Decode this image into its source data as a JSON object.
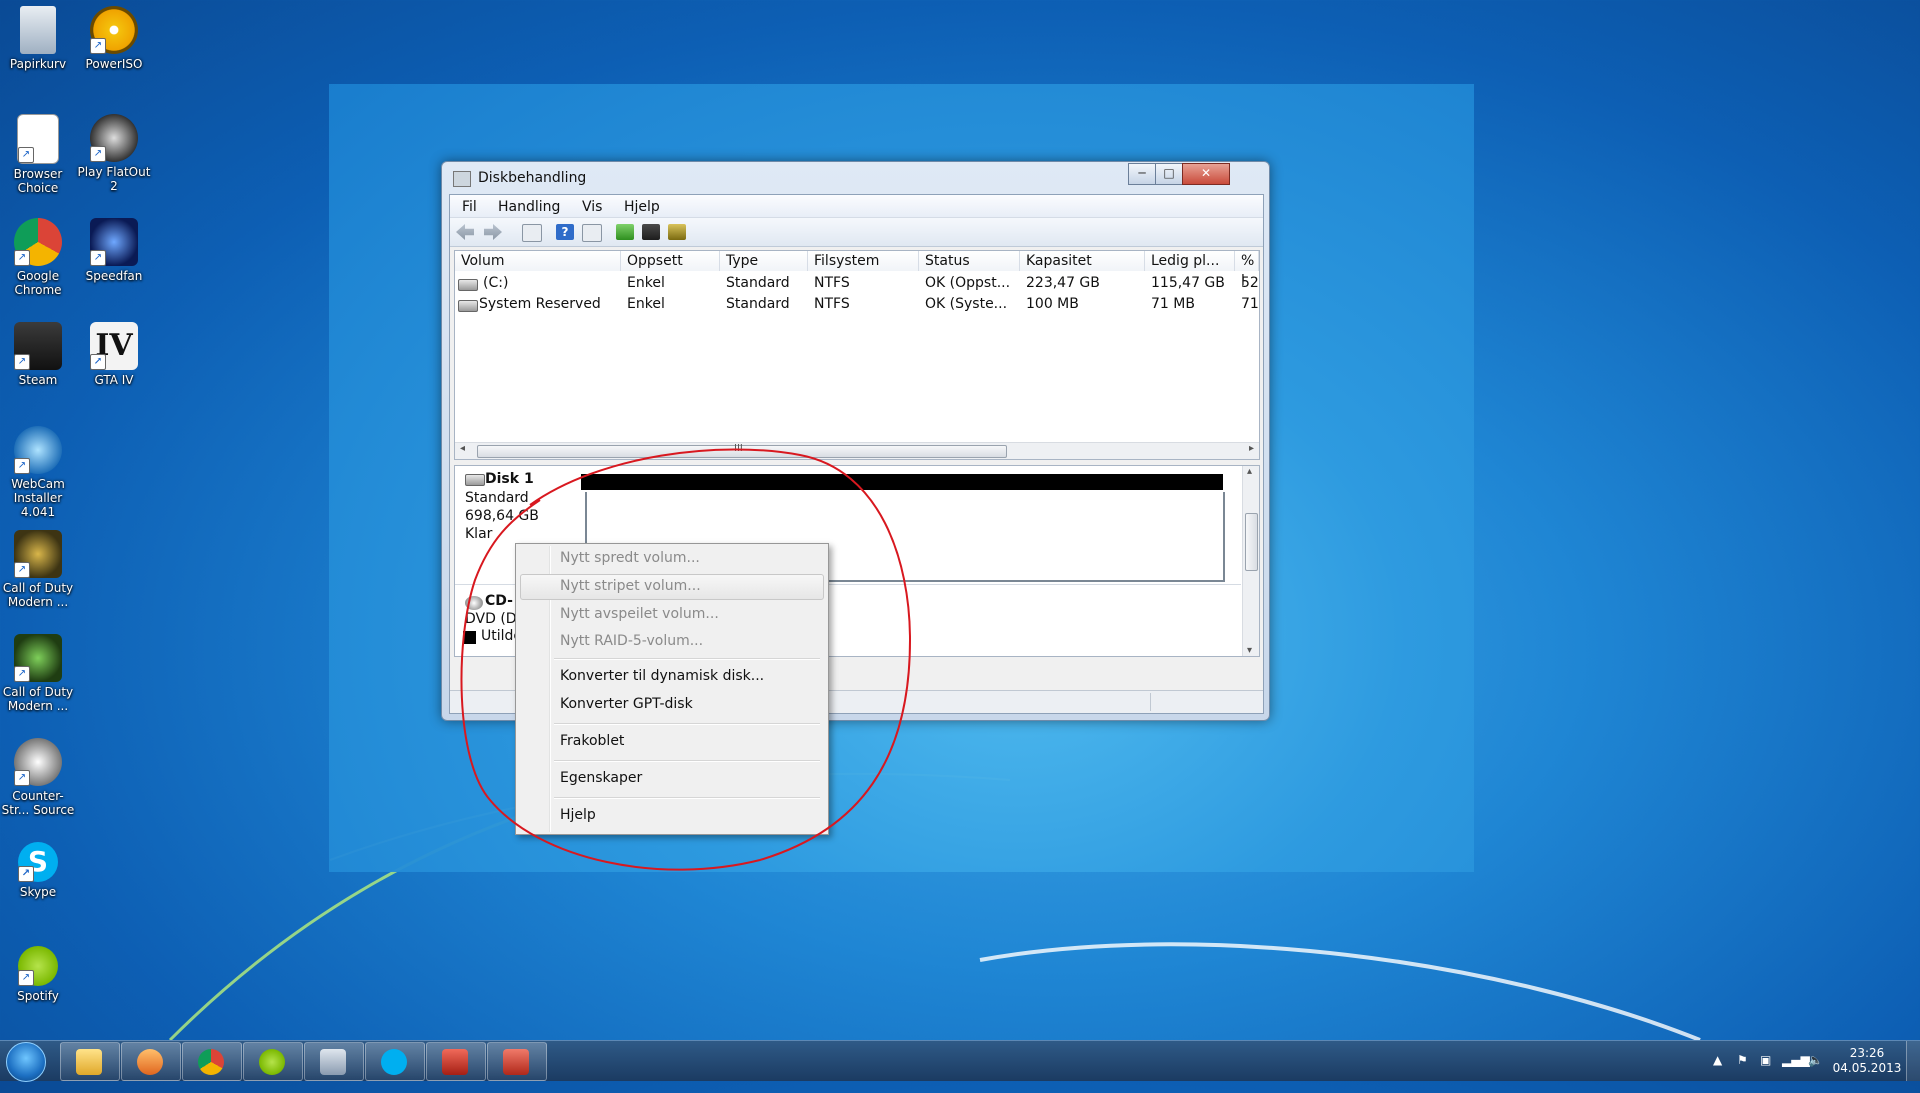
{
  "desktop": {
    "icons": [
      {
        "label": "Papirkurv",
        "icon": "recycle-bin-icon"
      },
      {
        "label": "PowerISO",
        "icon": "poweriso-icon"
      },
      {
        "label": "Browser Choice",
        "icon": "browser-choice-icon"
      },
      {
        "label": "Play FlatOut 2",
        "icon": "flatout-icon"
      },
      {
        "label": "Google Chrome",
        "icon": "chrome-icon"
      },
      {
        "label": "Speedfan",
        "icon": "speedfan-icon"
      },
      {
        "label": "Steam",
        "icon": "steam-icon"
      },
      {
        "label": "GTA IV",
        "icon": "gta-icon"
      },
      {
        "label": "WebCam Installer 4.041",
        "icon": "webcam-icon"
      },
      {
        "label": "Call of Duty Modern ...",
        "icon": "cod-icon"
      },
      {
        "label": "Call of Duty Modern ...",
        "icon": "cod-icon"
      },
      {
        "label": "Counter-Str... Source",
        "icon": "counter-strike-icon"
      },
      {
        "label": "Skype",
        "icon": "skype-icon"
      },
      {
        "label": "Spotify",
        "icon": "spotify-icon"
      }
    ]
  },
  "window": {
    "title": "Diskbehandling",
    "controls": {
      "minimize": "─",
      "maximize": "□",
      "close": "✕"
    },
    "menu": [
      "Fil",
      "Handling",
      "Vis",
      "Hjelp"
    ],
    "columns": [
      "Volum",
      "Oppsett",
      "Type",
      "Filsystem",
      "Status",
      "Kapasitet",
      "Ledig pl...",
      "% l"
    ],
    "rows": [
      [
        "(C:)",
        "Enkel",
        "Standard",
        "NTFS",
        "OK (Oppst...",
        "223,47 GB",
        "115,47 GB",
        "52"
      ],
      [
        "System Reserved",
        "Enkel",
        "Standard",
        "NTFS",
        "OK (Syste...",
        "100 MB",
        "71 MB",
        "71"
      ]
    ],
    "scroll_grip": "III",
    "disk1": {
      "name": "Disk 1",
      "type": "Standard",
      "size": "698,64 GB",
      "state": "Klar"
    },
    "cdrom": {
      "name": "CD-",
      "type": "DVD (D:",
      "state": "Utilde"
    }
  },
  "context_menu": {
    "disabled": [
      "Nytt spredt volum...",
      "Nytt stripet volum...",
      "Nytt avspeilet volum...",
      "Nytt RAID-5-volum..."
    ],
    "convert": [
      "Konverter til dynamisk disk...",
      "Konverter GPT-disk"
    ],
    "offline": "Frakoblet",
    "properties": "Egenskaper",
    "help": "Hjelp"
  },
  "taskbar": {
    "apps": [
      "explorer-icon",
      "media-player-icon",
      "chrome-icon",
      "spotify-icon",
      "disk-management-icon",
      "skype-icon",
      "mpc-icon",
      "toolbox-icon"
    ],
    "clock_time": "23:26",
    "clock_date": "04.05.2013"
  },
  "colors": {
    "annotation_circle": "#d8181f",
    "accent": "#1f86d4"
  }
}
